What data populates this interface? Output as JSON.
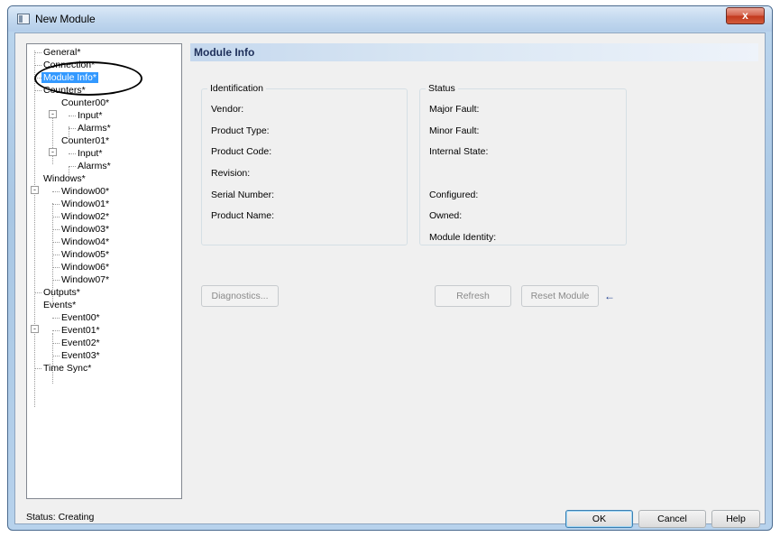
{
  "window": {
    "title": "New Module",
    "close_label": "x"
  },
  "tree": {
    "items": [
      {
        "label": "General*"
      },
      {
        "label": "Connection*"
      },
      {
        "label": "Module Info*"
      },
      {
        "label": "Counters*"
      },
      {
        "label": "Counter00*"
      },
      {
        "label": "Input*"
      },
      {
        "label": "Alarms*"
      },
      {
        "label": "Counter01*"
      },
      {
        "label": "Input*"
      },
      {
        "label": "Alarms*"
      },
      {
        "label": "Windows*"
      },
      {
        "label": "Window00*"
      },
      {
        "label": "Window01*"
      },
      {
        "label": "Window02*"
      },
      {
        "label": "Window03*"
      },
      {
        "label": "Window04*"
      },
      {
        "label": "Window05*"
      },
      {
        "label": "Window06*"
      },
      {
        "label": "Window07*"
      },
      {
        "label": "Outputs*"
      },
      {
        "label": "Events*"
      },
      {
        "label": "Event00*"
      },
      {
        "label": "Event01*"
      },
      {
        "label": "Event02*"
      },
      {
        "label": "Event03*"
      },
      {
        "label": "Time Sync*"
      }
    ],
    "selected_index": 2
  },
  "panel": {
    "title": "Module Info"
  },
  "identification": {
    "title": "Identification",
    "fields": [
      "Vendor:",
      "Product Type:",
      "Product Code:",
      "Revision:",
      "Serial Number:",
      "Product Name:"
    ]
  },
  "status": {
    "title": "Status",
    "fields": [
      "Major Fault:",
      "Minor Fault:",
      "Internal State:",
      "Configured:",
      "Owned:",
      "Module Identity:"
    ]
  },
  "buttons": {
    "diagnostics": "Diagnostics...",
    "refresh": "Refresh",
    "reset_module": "Reset Module",
    "ok": "OK",
    "cancel": "Cancel",
    "help": "Help"
  },
  "statusbar": {
    "text": "Status:  Creating"
  },
  "icons": {
    "arrow": "left-arrow-icon"
  },
  "colors": {
    "selection": "#3399ff",
    "header_band": "#c5d8ee"
  }
}
